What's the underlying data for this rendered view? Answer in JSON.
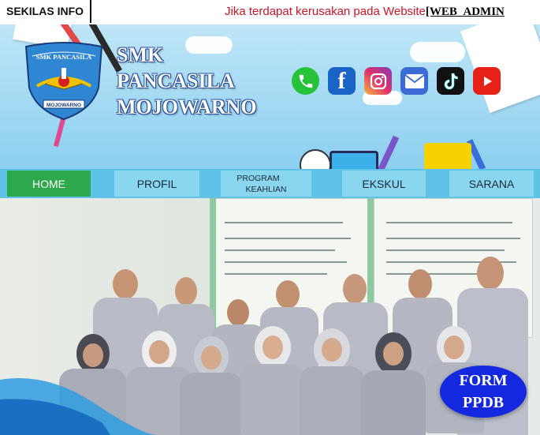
{
  "ticker": {
    "label": "SEKILAS INFO",
    "message": "Jika terdapat kerusakan pada Website",
    "admin": "[WEB_ADMIN"
  },
  "header": {
    "school_name_line1": "SMK",
    "school_name_line2": "PANCASILA",
    "school_name_line3": "MOJOWARNO",
    "logo_text_top": "SMK PANCASILA",
    "logo_text_bottom": "MOJOWARNO",
    "social_icons": [
      "whatsapp-icon",
      "facebook-icon",
      "instagram-icon",
      "email-icon",
      "tiktok-icon",
      "youtube-icon"
    ]
  },
  "nav": {
    "home": "HOME",
    "profil": "PROFIL",
    "program_line1": "PROGRAM",
    "program_line2": "KEAHLIAN",
    "ekskul": "EKSKUL",
    "sarana": "SARANA"
  },
  "ppdb": {
    "line1": "FORM",
    "line2": "PPDB"
  },
  "colors": {
    "ticker_text": "#d0142a",
    "nav_active": "#2ea84c",
    "nav_item": "#8ad6ef",
    "ppdb": "#1428e0"
  }
}
